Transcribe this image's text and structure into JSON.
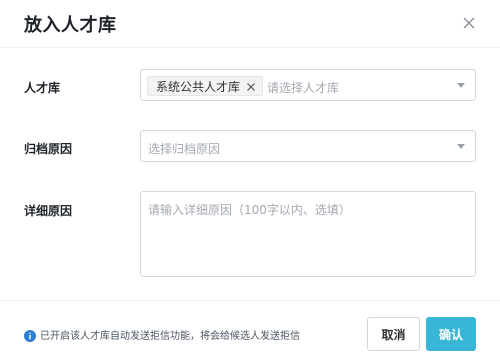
{
  "dialog": {
    "title": "放入人才库"
  },
  "form": {
    "talent_pool": {
      "label": "人才库",
      "selected_tag": "系统公共人才库",
      "placeholder": "请选择人才库"
    },
    "archive_reason": {
      "label": "归档原因",
      "placeholder": "选择归档原因"
    },
    "detail_reason": {
      "label": "详细原因",
      "placeholder": "请输入详细原因（100字以内、选填）"
    }
  },
  "footer": {
    "info_text": "已开启该人才库自动发送拒信功能，将会给候选人发送拒信",
    "cancel_label": "取消",
    "confirm_label": "确认"
  },
  "colors": {
    "accent": "#38b6d6",
    "info_icon": "#2d7fd3"
  },
  "icons": {
    "close": "close-icon",
    "tag_remove": "tag-remove-icon",
    "caret": "chevron-down-icon",
    "info": "info-icon"
  }
}
